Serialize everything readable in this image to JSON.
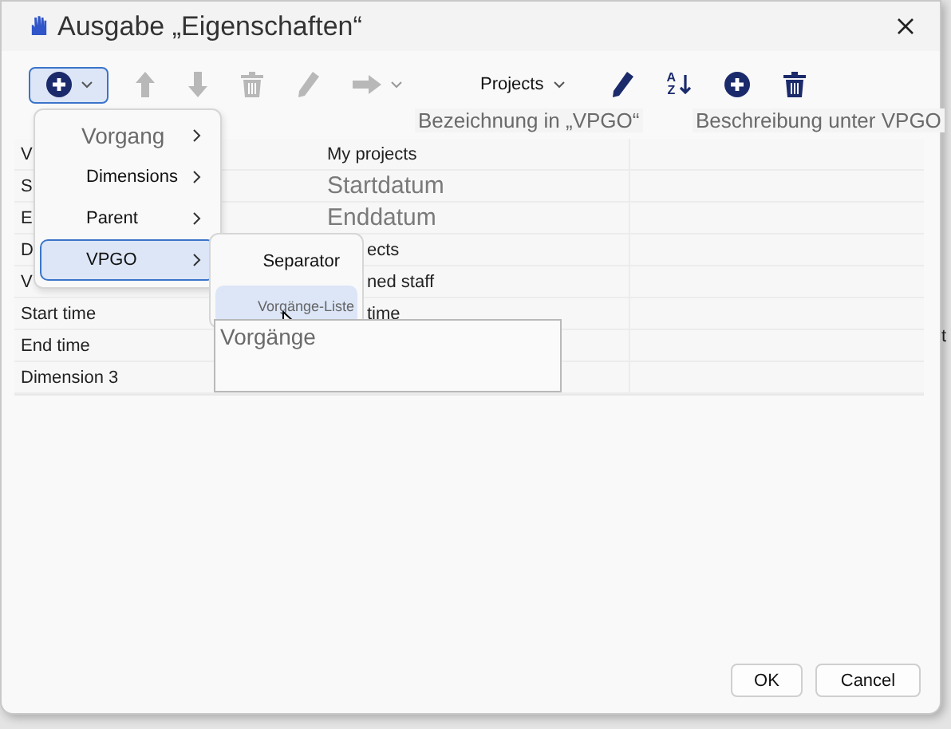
{
  "window": {
    "title": "Ausgabe „Eigenschaften“"
  },
  "toolbar": {
    "items": [
      {
        "kind": "add",
        "disabled": false,
        "selected": true
      },
      {
        "kind": "up",
        "disabled": true
      },
      {
        "kind": "down",
        "disabled": true
      },
      {
        "kind": "delete",
        "disabled": true
      },
      {
        "kind": "edit",
        "disabled": true
      },
      {
        "kind": "move",
        "disabled": true
      },
      {
        "kind": "dropdown",
        "label": "Projects"
      },
      {
        "kind": "edit",
        "disabled": false
      },
      {
        "kind": "sort",
        "disabled": false,
        "label_top": "A",
        "label_bottom": "Z"
      },
      {
        "kind": "add-plain",
        "disabled": false
      },
      {
        "kind": "delete",
        "disabled": false
      }
    ]
  },
  "annotations": [
    {
      "text": "Bezeichnung in „VPGO“"
    },
    {
      "text": "Beschreibung unter VPGO"
    }
  ],
  "grid": {
    "rows": [
      {
        "name": "V",
        "value": "My projects",
        "kind": "plain"
      },
      {
        "name": "S",
        "value": "Startdatum",
        "kind": "annotation"
      },
      {
        "name": "E",
        "value": "Enddatum",
        "kind": "annotation"
      },
      {
        "name": "D",
        "value": "ects",
        "kind": "partial"
      },
      {
        "name": "V",
        "value": "ned staff",
        "kind": "partial"
      },
      {
        "name": "Start time",
        "value": "time",
        "kind": "partial"
      },
      {
        "name": "End time"
      },
      {
        "name": "Dimension 3"
      }
    ]
  },
  "menu": {
    "items": [
      {
        "label": "Vorgang",
        "kind": "annotation",
        "selected": false
      },
      {
        "label": "Dimensions",
        "kind": "plain",
        "selected": false
      },
      {
        "label": "Parent",
        "kind": "plain",
        "selected": false
      },
      {
        "label": "VPGO",
        "kind": "plain",
        "selected": true
      }
    ]
  },
  "submenu": {
    "items": [
      {
        "label": "Separator",
        "kind": "plain",
        "selected": false
      },
      {
        "label": "Vorgänge-Liste",
        "kind": "small",
        "selected": true
      }
    ]
  },
  "text_box": {
    "text": "Vorgänge"
  },
  "background_text": "t",
  "buttons": [
    "OK",
    "Cancel"
  ]
}
